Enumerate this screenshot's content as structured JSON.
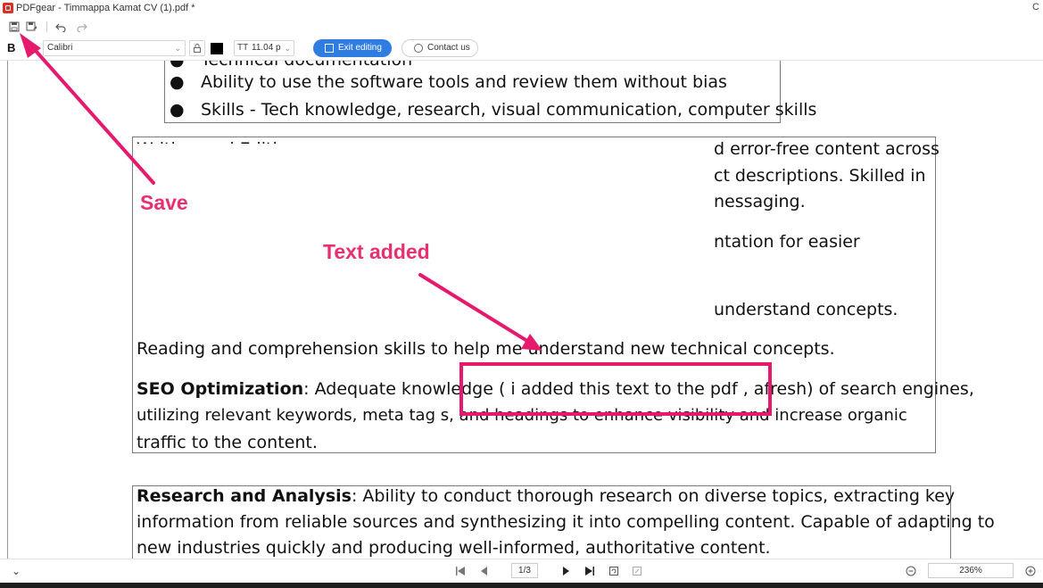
{
  "window": {
    "title": "PDFgear - Timmappa Kamat CV (1).pdf *",
    "control": "C"
  },
  "quickbar": {
    "icons": [
      "save-icon",
      "save-as-icon",
      "undo-icon",
      "redo-icon"
    ]
  },
  "formatbar": {
    "bold_label": "B",
    "font_name": "Calibri",
    "font_size": "11.04 p",
    "size_icon_text": "TT",
    "text_color": "#000000",
    "exit_editing_label": "Exit editing",
    "contact_label": "Contact us",
    "accent": "#2f7de1"
  },
  "document": {
    "bullets": [
      "Technical documentation",
      "Ability to use the software tools and review them without bias",
      "Skills - Tech knowledge, research, visual communication, computer skills"
    ],
    "writing_box": {
      "line1_left": "Writing and Editing: Proficient in creating well-researched, engaging,",
      "line1_right": "d error-free content across",
      "line2_right": "ct descriptions. Skilled in",
      "line3_right": "nessaging.",
      "line4_right": "ntation for easier",
      "line5_right": "understand concepts.",
      "reading": "Reading and comprehension skills to help me understand new technical concepts.",
      "seo_title": "SEO Optimization",
      "seo_text": ": Adequate knowledge ( i added this text to the pdf , afresh) of  search engines,",
      "seo_line2": "utilizing relevant keywords, meta tag s, and headings to enhance visibility and increase organic",
      "seo_line3": "traffic to the content."
    },
    "research_box": {
      "title": "Research and Analysis",
      "line1": ": Ability to conduct thorough research on diverse topics, extracting key",
      "line2": "information from reliable sources and synthesizing it into compelling content. Capable of adapting to",
      "line3": "new industries quickly and producing well-informed, authoritative content."
    }
  },
  "annotations": {
    "save_label": "Save",
    "text_added_label": "Text added",
    "color": "#e5196d"
  },
  "statusbar": {
    "page_indicator": "1/3",
    "zoom": "236%"
  }
}
